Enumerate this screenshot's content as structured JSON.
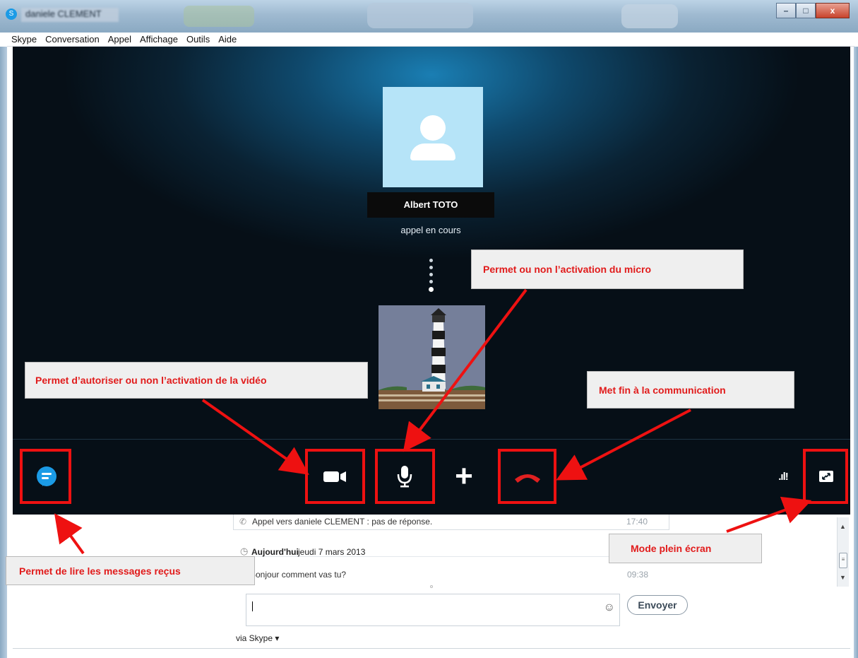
{
  "window": {
    "title": "daniele CLEMENT"
  },
  "menu": [
    "Skype",
    "Conversation",
    "Appel",
    "Affichage",
    "Outils",
    "Aide"
  ],
  "call": {
    "contact_name": "Albert TOTO",
    "status": "appel en cours"
  },
  "controls": {
    "chat_icon": "chat-bubble-icon",
    "video_icon": "video-camera-icon",
    "mic_icon": "microphone-icon",
    "add_icon": "plus-icon",
    "hangup_icon": "phone-hangup-icon",
    "signal_icon": "signal-strength-icon",
    "fullscreen_icon": "fullscreen-icon",
    "plus_glyph": "+",
    "signal_glyph": ".ıl!"
  },
  "chat": {
    "call_log": "Appel vers daniele CLEMENT : pas de réponse.",
    "call_log_time": "17:40",
    "today_label": "Aujourd'hui",
    "today_date": "jeudi 7 mars 2013",
    "message": "Bonjour comment vas tu?",
    "message_time": "09:38",
    "input_value": "",
    "send_label": "Envoyer",
    "via": "via Skype ▾"
  },
  "annotations": {
    "mic": "Permet ou non l’activation du micro",
    "video": "Permet d’autoriser ou non l’activation de la vidéo",
    "hangup": "Met fin à la communication",
    "fullscreen": "Mode plein écran",
    "messages": "Permet de lire les messages reçus"
  },
  "colors": {
    "annotation_red": "#ee1111",
    "skype_blue": "#1b9be6",
    "hangup_red": "#e02020"
  }
}
